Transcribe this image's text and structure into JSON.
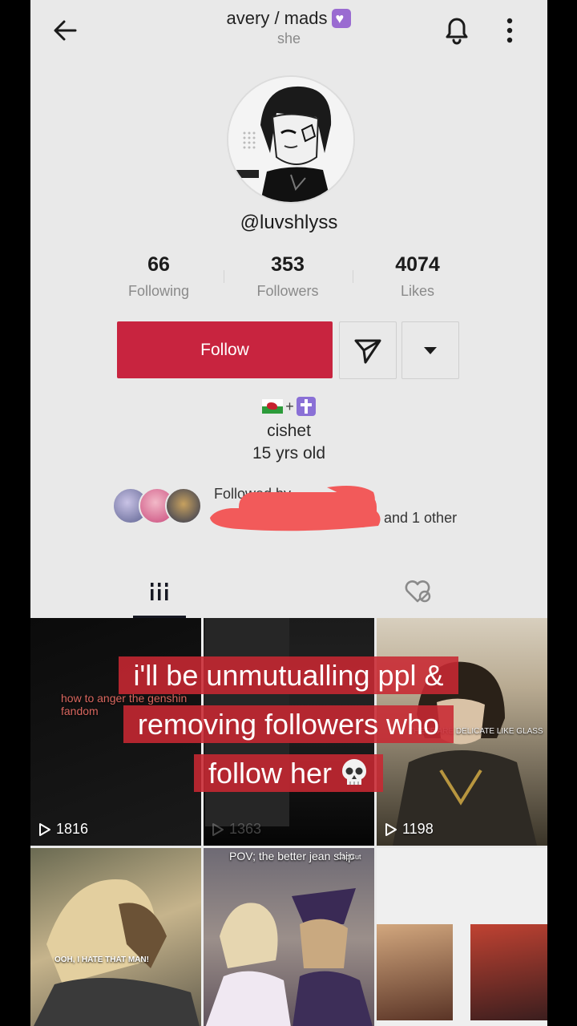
{
  "header": {
    "title": "avery / mads",
    "pronoun": "she",
    "title_badge_icon": "purple-heart-icon"
  },
  "profile": {
    "username": "@luvshlyss",
    "stats": [
      {
        "value": "66",
        "label": "Following"
      },
      {
        "value": "353",
        "label": "Followers"
      },
      {
        "value": "4074",
        "label": "Likes"
      }
    ],
    "follow_label": "Follow",
    "bio_icons": [
      "wales-flag-icon",
      "plus",
      "latin-cross-icon"
    ],
    "bio_plus": "+",
    "bio_lines": [
      "cishet",
      "15 yrs old"
    ],
    "followed_by_label": "Followed by",
    "followed_by_suffix": "and 1 other"
  },
  "tabs": [
    {
      "icon": "grid-icon",
      "active": true
    },
    {
      "icon": "liked-hidden-icon",
      "active": false
    }
  ],
  "videos": [
    {
      "views": "1816",
      "caption": "how to anger the genshin fandom"
    },
    {
      "views": "1363",
      "caption": ""
    },
    {
      "views": "1198",
      "caption": "THESE ARE DELICATE LIKE GLASS"
    },
    {
      "views": "",
      "caption": "OOH, I HATE THAT MAN!"
    },
    {
      "views": "",
      "caption": "POV; the better jean ship",
      "watermark": "CapCut"
    },
    {
      "views": "",
      "caption": ""
    }
  ],
  "overlay_caption": [
    "i'll be unmutualling ppl &",
    "removing followers who",
    "follow her"
  ],
  "colors": {
    "follow_button": "#c8243f",
    "overlay_bg": "#c82832",
    "page_bg": "#e9e9e9"
  }
}
